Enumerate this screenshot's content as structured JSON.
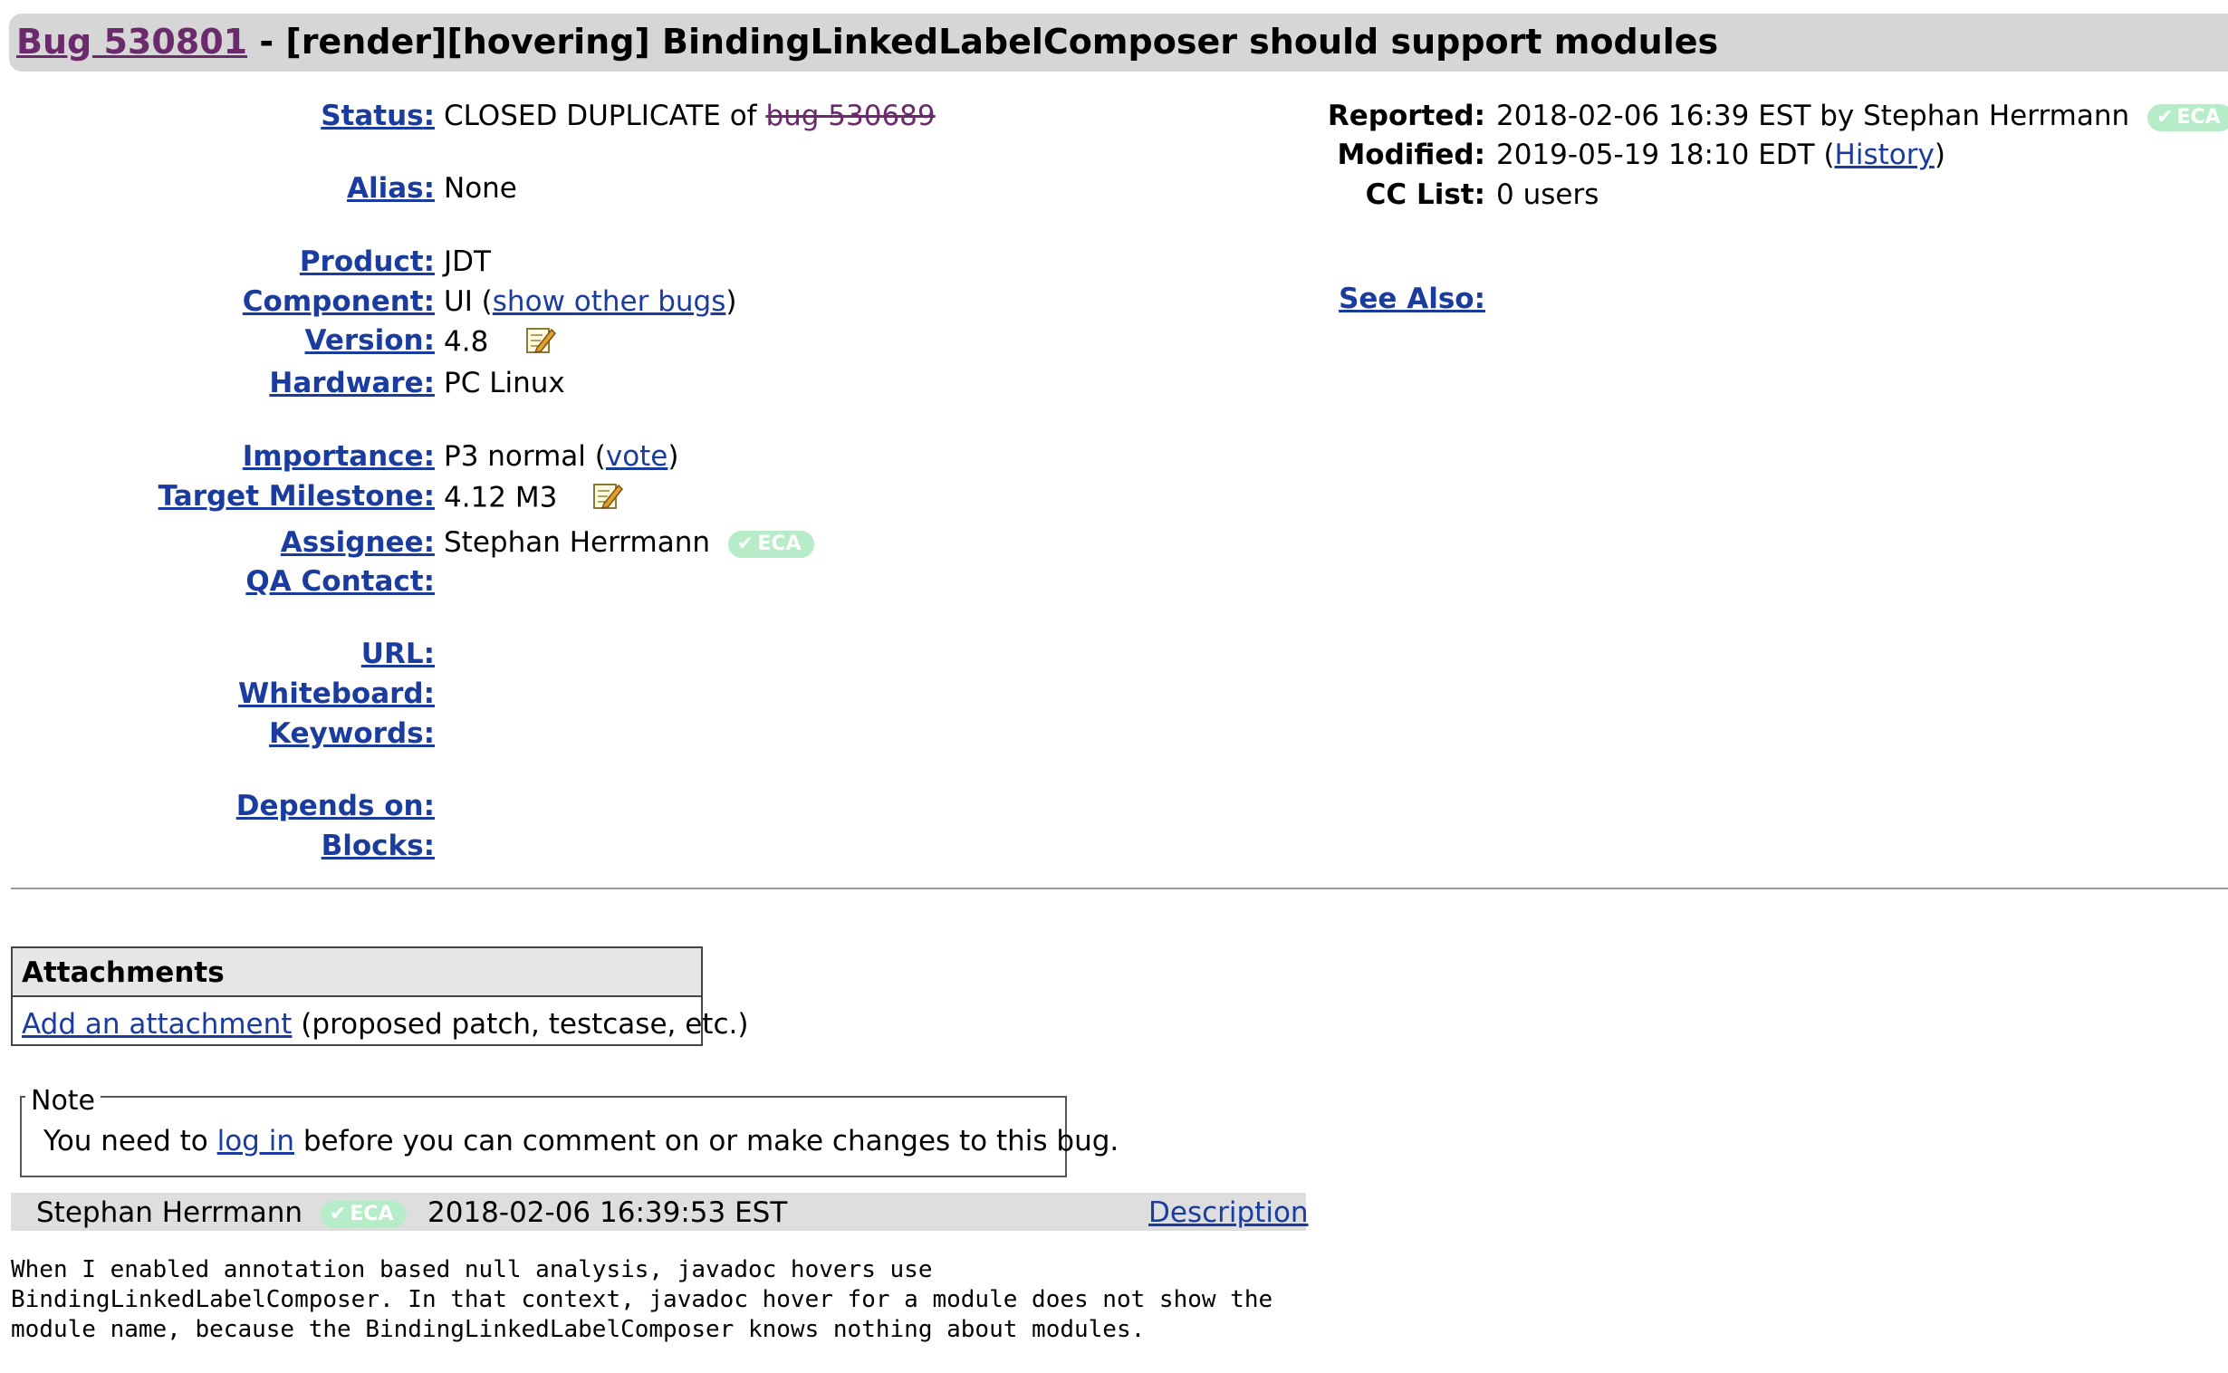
{
  "header": {
    "bug_link": "Bug 530801",
    "separator": " - ",
    "summary": "[render][hovering] BindingLinkedLabelComposer should support modules"
  },
  "fields": {
    "status": {
      "label": "Status",
      "colon": ":",
      "value": "CLOSED DUPLICATE of ",
      "dup_link": "bug 530689"
    },
    "alias": {
      "label": "Alias:",
      "value": "None"
    },
    "product": {
      "label": "Product:",
      "value": "JDT"
    },
    "component": {
      "label": "Component:",
      "value": "UI (",
      "link": "show other bugs",
      "close": ")"
    },
    "version": {
      "label": "Version:",
      "value": "4.8",
      "icon": "edit-pencil-icon"
    },
    "hardware": {
      "label": "Hardware:",
      "value": "PC Linux"
    },
    "importance": {
      "label": "Importance",
      "colon": ":",
      "value": "P3 normal (",
      "link": "vote",
      "close": ")"
    },
    "target_milestone": {
      "label": "Target Milestone:",
      "value": "4.12 M3",
      "icon": "edit-pencil-icon"
    },
    "assignee": {
      "label": "Assignee:",
      "value": "Stephan Herrmann",
      "badge": "ECA"
    },
    "qa_contact": {
      "label": "QA Contact:",
      "value": ""
    },
    "url": {
      "label": "URL:",
      "value": ""
    },
    "whiteboard": {
      "label": "Whiteboard:",
      "value": ""
    },
    "keywords": {
      "label": "Keywords:",
      "value": ""
    },
    "depends_on": {
      "label": "Depends on:",
      "value": ""
    },
    "blocks": {
      "label": "Blocks:",
      "value": ""
    }
  },
  "side_fields": {
    "reported": {
      "label": "Reported:",
      "value": "2018-02-06 16:39 EST by Stephan Herrmann",
      "badge": "ECA"
    },
    "modified": {
      "label": "Modified:",
      "value": "2019-05-19 18:10 EDT (",
      "link": "History",
      "close": ")"
    },
    "cc_list": {
      "label": "CC List:",
      "value": "0 users"
    },
    "see_also": {
      "label": "See Also:"
    }
  },
  "attachments": {
    "title": "Attachments",
    "add_link": "Add an attachment",
    "add_hint": " (proposed patch, testcase, etc.)"
  },
  "note": {
    "legend": "Note",
    "text_before": "You need to ",
    "login_link": "log in",
    "text_after": " before you can comment on or make changes to this bug."
  },
  "comment": {
    "author": "Stephan Herrmann",
    "badge": "ECA",
    "timestamp": "2018-02-06 16:39:53 EST",
    "description_link": "Description",
    "text": "When I enabled annotation based null analysis, javadoc hovers use\nBindingLinkedLabelComposer. In that context, javadoc hover for a module does not show the\nmodule name, because the BindingLinkedLabelComposer knows nothing about modules."
  },
  "colors": {
    "link": "#1a3c9e",
    "visited_link": "#6b2a6b",
    "header_bar": "#d6d6d6",
    "eca_badge": "#b7ecc8"
  }
}
